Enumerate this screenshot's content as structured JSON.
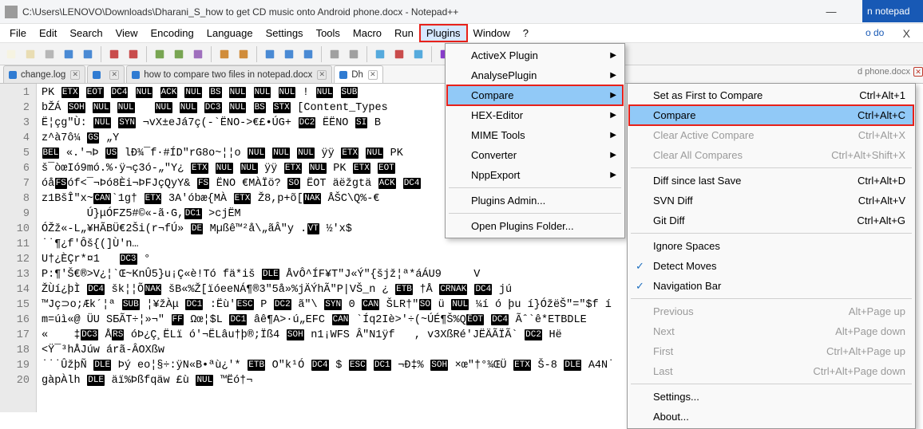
{
  "window": {
    "title": "C:\\Users\\LENOVO\\Downloads\\Dharani_S_how to get CD music onto Android phone.docx - Notepad++",
    "min_glyph": "—",
    "max_glyph": "☐",
    "close_glyph": "✕"
  },
  "menubar": {
    "items": [
      "File",
      "Edit",
      "Search",
      "View",
      "Encoding",
      "Language",
      "Settings",
      "Tools",
      "Macro",
      "Run",
      "Plugins",
      "Window",
      "?"
    ],
    "highlight_index": 10,
    "close_x": "X"
  },
  "tabs": {
    "items": [
      {
        "label": "change.log",
        "icon": "blue"
      },
      {
        "label": "",
        "icon": "blue"
      },
      {
        "label": "how to compare two files in notepad.docx",
        "icon": "blue"
      },
      {
        "label": "Dh",
        "icon": "blue",
        "active": true
      }
    ],
    "overflow_label": "d phone.docx"
  },
  "dropdown1": {
    "items": [
      {
        "label": "ActiveX Plugin",
        "sub": true
      },
      {
        "label": "AnalysePlugin",
        "sub": true
      },
      {
        "label": "Compare",
        "sub": true,
        "sel": true,
        "highlight": true
      },
      {
        "label": "HEX-Editor",
        "sub": true
      },
      {
        "label": "MIME Tools",
        "sub": true
      },
      {
        "label": "Converter",
        "sub": true
      },
      {
        "label": "NppExport",
        "sub": true
      },
      {
        "sep": true
      },
      {
        "label": "Plugins Admin..."
      },
      {
        "sep": true
      },
      {
        "label": "Open Plugins Folder..."
      }
    ]
  },
  "dropdown2": {
    "items": [
      {
        "label": "Set as First to Compare",
        "shortcut": "Ctrl+Alt+1"
      },
      {
        "label": "Compare",
        "shortcut": "Ctrl+Alt+C",
        "sel": true,
        "highlight": true
      },
      {
        "label": "Clear Active Compare",
        "shortcut": "Ctrl+Alt+X",
        "disabled": true
      },
      {
        "label": "Clear All Compares",
        "shortcut": "Ctrl+Alt+Shift+X",
        "disabled": true
      },
      {
        "sep": true
      },
      {
        "label": "Diff since last Save",
        "shortcut": "Ctrl+Alt+D"
      },
      {
        "label": "SVN Diff",
        "shortcut": "Ctrl+Alt+V"
      },
      {
        "label": "Git Diff",
        "shortcut": "Ctrl+Alt+G"
      },
      {
        "sep": true
      },
      {
        "label": "Ignore Spaces"
      },
      {
        "label": "Detect Moves",
        "check": true
      },
      {
        "label": "Navigation Bar",
        "check": true
      },
      {
        "sep": true
      },
      {
        "label": "Previous",
        "shortcut": "Alt+Page up",
        "disabled": true
      },
      {
        "label": "Next",
        "shortcut": "Alt+Page down",
        "disabled": true
      },
      {
        "label": "First",
        "shortcut": "Ctrl+Alt+Page up",
        "disabled": true
      },
      {
        "label": "Last",
        "shortcut": "Ctrl+Alt+Page down",
        "disabled": true
      },
      {
        "sep": true
      },
      {
        "label": "Settings..."
      },
      {
        "label": "About..."
      }
    ]
  },
  "sidehint": {
    "band": "n notepad",
    "txt": "o do"
  },
  "gutter": {
    "start": 1,
    "end": 20
  },
  "code_plain": [
    "PK ETX EOT DC4 NUL ACK NUL BS NUL NUL NUL ! NUL SUB",
    "bŽÁ SOH NUL NUL   NUL NUL DC3 NUL BS STX [Content_Types",
    "Ë¦çg\"Ù: NUL SYN ¬vX±eJá7ç(-`ËNO->€£•ÚG+ DC2 ËËNO SI B",
    "z^à7ô¼ GS „Y",
    "BEL «.'¬Þ US lÐ¾¯f·#ÍD\"rG8o~¦¦o NUL NUL NUL ÿÿ ETX NUL PK",
    "š¯òœIó9mó.%·ÿ¬ç3ó-„\"Y¿ ETX NUL NUL ÿÿ ETX NUL PK ETX EOT",
    "óåFSóf<¯¬Þó8Èi¬ÞFJçQyY& FS ËNO €MÀÏö? SO ËOT äëžgtä ACK DC4",
    "z1BšÎ\"x~CAN`1g† ETX 3A'óbæ{MÀ ETX Ž8,p+õ[NAK ÅŠC\\Q%-€",
    "       Ú}μÓFZ5#©«-ã·G,DC1 >cjËM",
    "ÓŽž«-L„¥HÃBÜ€2Ši(r¬fÚ» DE Mµßê™²å\\„ãÂ\"y .VT ½'x$",
    "˙˙¶¿f'Ôš{(]Ù'n…",
    "U†¿ÈÇr*¤1   DC3 °",
    "P:¶'Š€®>V¿¦`Œ~KnÛ5}u¡Ç«è!Tó fä*iš DLE ÅvÔ^ÍF¥T\"J«Ý\"{šjž¦ª*áÁU9     V",
    "ŽÙí¿þÌ DC4 šk¦¦ÕNAK šB«%Ž[ïóeeNÁ¶®3\"5å»%jÄÝhÃ\"P|VŠ_n ¿ ETB †Å CRNAK DC4 jú",
    "™Jç⊃o;Æk´¦ª SUB ¦¥žÀμ DC1 :Ëù'ESC P DC2 ã\"\\ SYN 0 CAN ŠLR†\"SO ü NUL ¼í ó þu í}ÓžëŠ\"=\"$f í",
    "m=úì«@ ÜU SБÃT÷¦»¬\" FF Ωœ¦$L DC1 âê¶A>·ú„EFC CAN `Íq2Iè>'÷(~ÚÉ¶Š%QËOT DC4 Ãˆ`ê*ETBDLE",
    "«    ‡DC3 ÅRS óÞ¿Ç¸ËLï ó'¬ËLâu†þ®;Ïß4 SOH n1¡WFS Â\"N1ÿf   , v3XßRé'JËÄÃÏÃ` DC2 Hë",
    "<Ÿ¯³hÅJúw árã-ÂOXßw",
    "˙˙˙ÛžþÑ DLE Þý eo¦§÷:ÿN«B•ªù¿'* ETB O\"k¹Ó DC4 $ ESC DC1 ¬Ð‡% SOH ×œ\"†°¾ŒÜ ETX Š-8 DLE A4N˙",
    "gàpÀlh DLE äï%Þßfqäw £ù NUL ™Ëó†¬"
  ]
}
